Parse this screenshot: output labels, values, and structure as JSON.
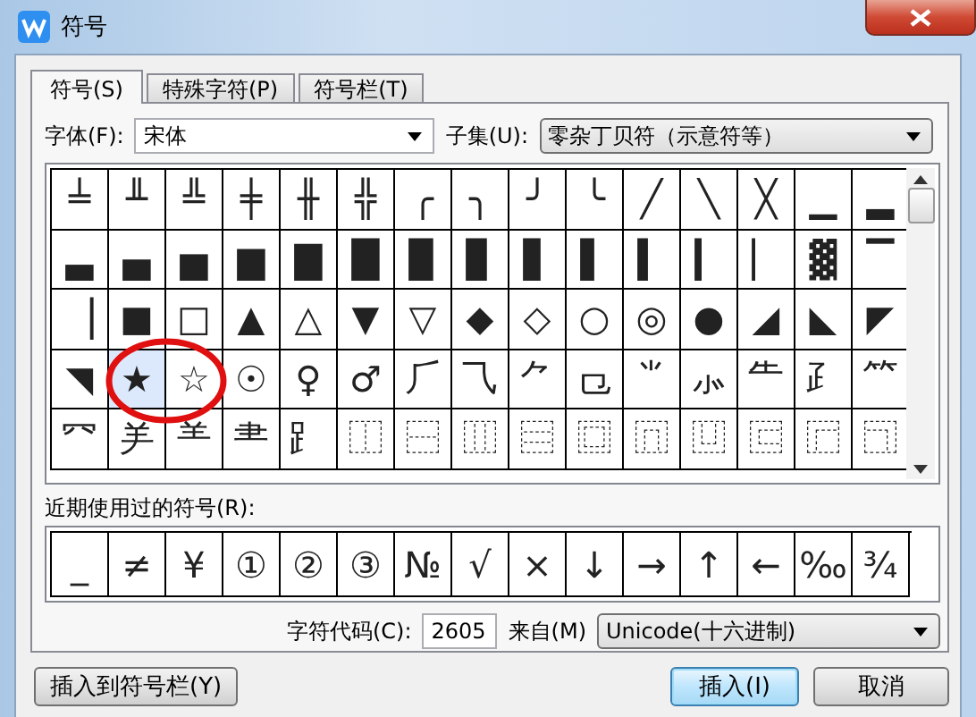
{
  "window": {
    "title": "符号"
  },
  "tabs": [
    {
      "label": "符号(S)",
      "selected": true
    },
    {
      "label": "特殊字符(P)",
      "selected": false
    },
    {
      "label": "符号栏(T)",
      "selected": false
    }
  ],
  "font_field": {
    "label": "字体(F):",
    "value": "宋体"
  },
  "subset_field": {
    "label": "子集(U):",
    "value": "零杂丁贝符（示意符等）"
  },
  "symbols": [
    {
      "char": "╧",
      "selected": false
    },
    {
      "char": "╨",
      "selected": false
    },
    {
      "char": "╩",
      "selected": false
    },
    {
      "char": "╪",
      "selected": false
    },
    {
      "char": "╫",
      "selected": false
    },
    {
      "char": "╬",
      "selected": false
    },
    {
      "char": "╭",
      "selected": false
    },
    {
      "char": "╮",
      "selected": false
    },
    {
      "char": "╯",
      "selected": false
    },
    {
      "char": "╰",
      "selected": false
    },
    {
      "char": "╱",
      "selected": false
    },
    {
      "char": "╲",
      "selected": false
    },
    {
      "char": "╳",
      "selected": false
    },
    {
      "char": "▁",
      "selected": false
    },
    {
      "char": "▂",
      "selected": false
    },
    {
      "char": "▃",
      "selected": false
    },
    {
      "char": "▄",
      "selected": false
    },
    {
      "char": "▅",
      "selected": false
    },
    {
      "char": "▆",
      "selected": false
    },
    {
      "char": "▇",
      "selected": false
    },
    {
      "char": "█",
      "selected": false
    },
    {
      "char": "▉",
      "selected": false
    },
    {
      "char": "▊",
      "selected": false
    },
    {
      "char": "▋",
      "selected": false
    },
    {
      "char": "▌",
      "selected": false
    },
    {
      "char": "▍",
      "selected": false
    },
    {
      "char": "▎",
      "selected": false
    },
    {
      "char": "▏",
      "selected": false
    },
    {
      "char": "▓",
      "selected": false
    },
    {
      "char": "▔",
      "selected": false
    },
    {
      "char": "▕",
      "selected": false
    },
    {
      "char": "■",
      "selected": false
    },
    {
      "char": "□",
      "selected": false
    },
    {
      "char": "▲",
      "selected": false
    },
    {
      "char": "△",
      "selected": false
    },
    {
      "char": "▼",
      "selected": false
    },
    {
      "char": "▽",
      "selected": false
    },
    {
      "char": "◆",
      "selected": false
    },
    {
      "char": "◇",
      "selected": false
    },
    {
      "char": "○",
      "selected": false
    },
    {
      "char": "◎",
      "selected": false
    },
    {
      "char": "●",
      "selected": false
    },
    {
      "char": "◢",
      "selected": false
    },
    {
      "char": "◣",
      "selected": false
    },
    {
      "char": "◤",
      "selected": false
    },
    {
      "char": "◥",
      "selected": false
    },
    {
      "char": "★",
      "selected": true
    },
    {
      "char": "☆",
      "selected": false
    },
    {
      "char": "☉",
      "selected": false
    },
    {
      "char": "♀",
      "selected": false
    },
    {
      "char": "♂",
      "selected": false
    },
    {
      "char": "⺁",
      "selected": false
    },
    {
      "char": "⺄",
      "selected": false
    },
    {
      "char": "⺈",
      "selected": false
    },
    {
      "char": "⺋",
      "selected": false
    },
    {
      "char": "⺌",
      "selected": false
    },
    {
      "char": "⺗",
      "selected": false
    },
    {
      "char": "⺧",
      "selected": false
    },
    {
      "char": "⺪",
      "selected": false
    },
    {
      "char": "⺮",
      "selected": false
    },
    {
      "char": "⺳",
      "selected": false
    },
    {
      "char": "⺶",
      "selected": false
    },
    {
      "char": "⺷",
      "selected": false
    },
    {
      "char": "⺻",
      "selected": false
    },
    {
      "char": "⻊",
      "selected": false
    },
    {
      "char": "⿰",
      "selected": false
    },
    {
      "char": "⿱",
      "selected": false
    },
    {
      "char": "⿲",
      "selected": false
    },
    {
      "char": "⿳",
      "selected": false
    },
    {
      "char": "⿴",
      "selected": false
    },
    {
      "char": "⿵",
      "selected": false
    },
    {
      "char": "⿶",
      "selected": false
    },
    {
      "char": "⿷",
      "selected": false
    },
    {
      "char": "⿸",
      "selected": false
    },
    {
      "char": "⿹",
      "selected": false
    }
  ],
  "recent_label": "近期使用过的符号(R):",
  "recent": [
    "_",
    "≠",
    "¥",
    "①",
    "②",
    "③",
    "№",
    "√",
    "×",
    "↓",
    "→",
    "↑",
    "←",
    "‰",
    "¾"
  ],
  "char_code": {
    "label": "字符代码(C):",
    "value": "2605"
  },
  "from_field": {
    "label": "来自(M)",
    "value": "Unicode(十六进制)"
  },
  "buttons": [
    {
      "label": "插入到符号栏(Y)",
      "kind": "plain"
    },
    {
      "label": "插入(I)",
      "kind": "default"
    },
    {
      "label": "取消",
      "kind": "plain"
    }
  ]
}
